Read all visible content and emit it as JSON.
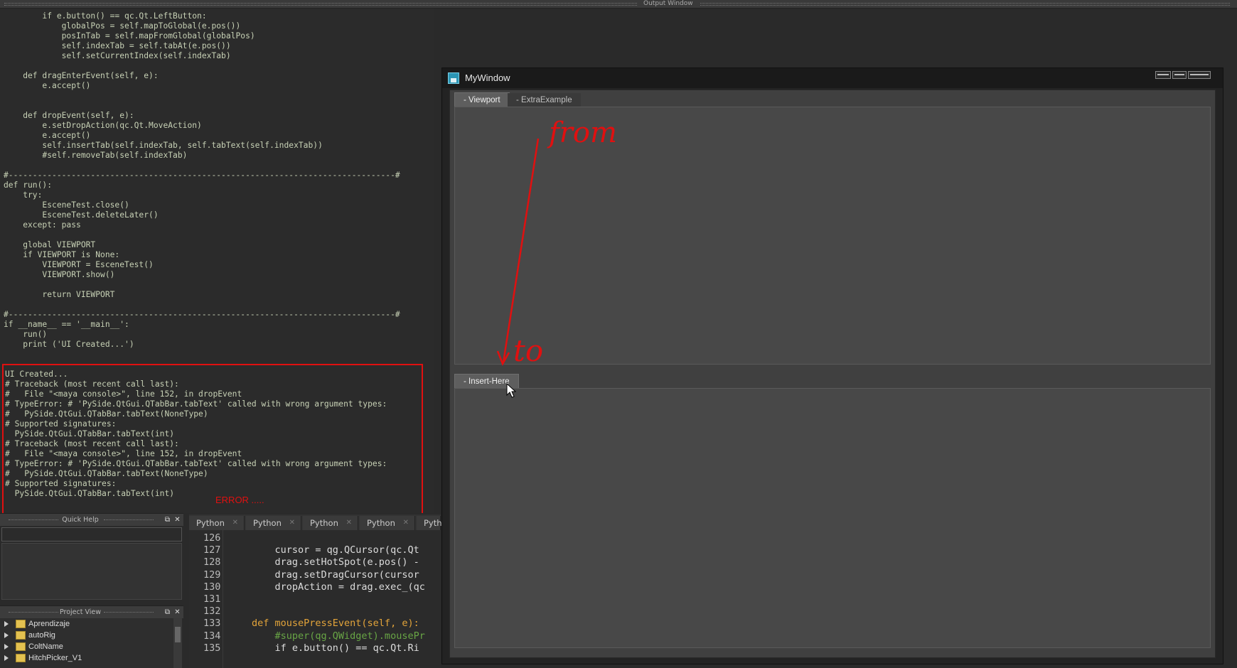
{
  "output_window": {
    "title": "Output Window",
    "code_lines": [
      "        if e.button() == qc.Qt.LeftButton:",
      "            globalPos = self.mapToGlobal(e.pos())",
      "            posInTab = self.mapFromGlobal(globalPos)",
      "            self.indexTab = self.tabAt(e.pos())",
      "            self.setCurrentIndex(self.indexTab)",
      "",
      "    def dragEnterEvent(self, e):",
      "        e.accept()",
      "",
      "",
      "    def dropEvent(self, e):",
      "        e.setDropAction(qc.Qt.MoveAction)",
      "        e.accept()",
      "        self.insertTab(self.indexTab, self.tabText(self.indexTab))",
      "        #self.removeTab(self.indexTab)",
      "",
      "#--------------------------------------------------------------------------------#",
      "def run():",
      "    try:",
      "        EsceneTest.close()",
      "        EsceneTest.deleteLater()",
      "    except: pass",
      "",
      "    global VIEWPORT",
      "    if VIEWPORT is None:",
      "        VIEWPORT = EsceneTest()",
      "        VIEWPORT.show()",
      "",
      "        return VIEWPORT",
      "",
      "#--------------------------------------------------------------------------------#",
      "if __name__ == '__main__':",
      "    run()",
      "    print ('UI Created...')"
    ],
    "error_lines": [
      "UI Created...",
      "# Traceback (most recent call last):",
      "#   File \"<maya console>\", line 152, in dropEvent",
      "# TypeError: # 'PySide.QtGui.QTabBar.tabText' called with wrong argument types:",
      "#   PySide.QtGui.QTabBar.tabText(NoneType)",
      "# Supported signatures:",
      "  PySide.QtGui.QTabBar.tabText(int)",
      "# Traceback (most recent call last):",
      "#   File \"<maya console>\", line 152, in dropEvent",
      "# TypeError: # 'PySide.QtGui.QTabBar.tabText' called with wrong argument types:",
      "#   PySide.QtGui.QTabBar.tabText(NoneType)",
      "# Supported signatures:",
      "  PySide.QtGui.QTabBar.tabText(int)"
    ],
    "error_annotation": "ERROR .....",
    "error_color": "#e01010"
  },
  "quick_help": {
    "title": "Quick Help",
    "float_icon": "float-icon",
    "close_icon": "close-icon"
  },
  "project_view": {
    "title": "Project View",
    "items": [
      {
        "label": "Aprendizaje"
      },
      {
        "label": "autoRig"
      },
      {
        "label": "ColtName"
      },
      {
        "label": "HitchPicker_V1"
      }
    ]
  },
  "script_editor": {
    "tabs": [
      {
        "label": "Python"
      },
      {
        "label": "Python"
      },
      {
        "label": "Python"
      },
      {
        "label": "Python"
      },
      {
        "label": "Pyth"
      }
    ],
    "lines": [
      {
        "num": "126",
        "code": ""
      },
      {
        "num": "127",
        "code": "    cursor = qg.QCursor(qc.Qt"
      },
      {
        "num": "128",
        "code": "    drag.setHotSpot(e.pos() -"
      },
      {
        "num": "129",
        "code": "    drag.setDragCursor(cursor"
      },
      {
        "num": "130",
        "code": "    dropAction = drag.exec_(qc"
      },
      {
        "num": "131",
        "code": ""
      },
      {
        "num": "132",
        "code": ""
      },
      {
        "num": "133",
        "code": "def mousePressEvent(self, e):"
      },
      {
        "num": "134",
        "code": "    #super(qg.QWidget).mousePr"
      },
      {
        "num": "135",
        "code": "    if e.button() == qc.Qt.Ri"
      }
    ]
  },
  "my_window": {
    "title": "MyWindow",
    "top_tabs": [
      {
        "label": "- Viewport",
        "active": true
      },
      {
        "label": "- ExtraExample",
        "active": false
      }
    ],
    "bottom_tabs": [
      {
        "label": "- Insert-Here",
        "active": true
      }
    ],
    "controls": [
      "minimize",
      "maximize",
      "close"
    ]
  },
  "annotations": {
    "from_label": "from",
    "to_label": "to",
    "color": "#e01010"
  }
}
